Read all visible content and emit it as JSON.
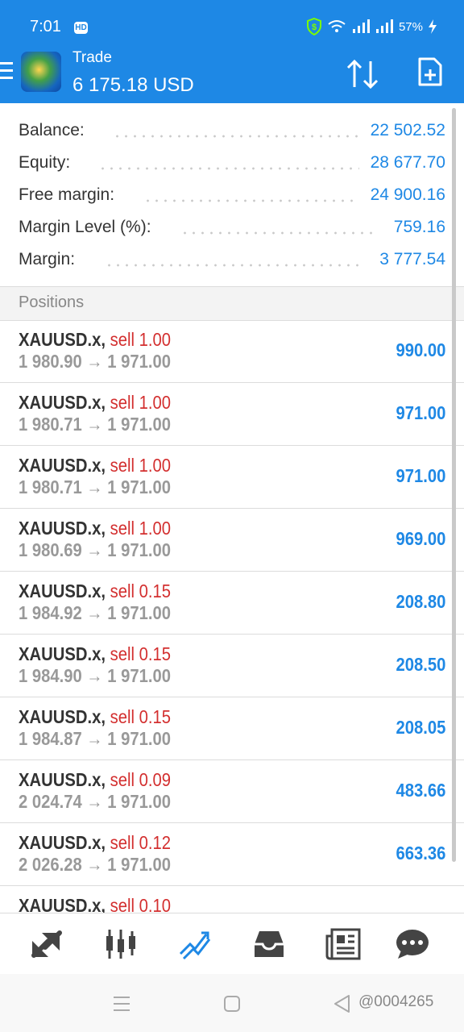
{
  "status": {
    "time": "7:01",
    "hd": "HD",
    "battery": "57%"
  },
  "header": {
    "title": "Trade",
    "subtitle": "6 175.18 USD"
  },
  "summary": [
    {
      "label": "Balance:",
      "value": "22 502.52"
    },
    {
      "label": "Equity:",
      "value": "28 677.70"
    },
    {
      "label": "Free margin:",
      "value": "24 900.16"
    },
    {
      "label": "Margin Level (%):",
      "value": "759.16"
    },
    {
      "label": "Margin:",
      "value": "3 777.54"
    }
  ],
  "positions_header": "Positions",
  "positions": [
    {
      "symbol": "XAUUSD.x,",
      "direction": "sell 1.00",
      "prices": "1 980.90 → 1 971.00",
      "profit": "990.00"
    },
    {
      "symbol": "XAUUSD.x,",
      "direction": "sell 1.00",
      "prices": "1 980.71 → 1 971.00",
      "profit": "971.00"
    },
    {
      "symbol": "XAUUSD.x,",
      "direction": "sell 1.00",
      "prices": "1 980.71 → 1 971.00",
      "profit": "971.00"
    },
    {
      "symbol": "XAUUSD.x,",
      "direction": "sell 1.00",
      "prices": "1 980.69 → 1 971.00",
      "profit": "969.00"
    },
    {
      "symbol": "XAUUSD.x,",
      "direction": "sell 0.15",
      "prices": "1 984.92 → 1 971.00",
      "profit": "208.80"
    },
    {
      "symbol": "XAUUSD.x,",
      "direction": "sell 0.15",
      "prices": "1 984.90 → 1 971.00",
      "profit": "208.50"
    },
    {
      "symbol": "XAUUSD.x,",
      "direction": "sell 0.15",
      "prices": "1 984.87 → 1 971.00",
      "profit": "208.05"
    },
    {
      "symbol": "XAUUSD.x,",
      "direction": "sell 0.09",
      "prices": "2 024.74 → 1 971.00",
      "profit": "483.66"
    },
    {
      "symbol": "XAUUSD.x,",
      "direction": "sell 0.12",
      "prices": "2 026.28 → 1 971.00",
      "profit": "663.36"
    },
    {
      "symbol": "XAUUSD.x,",
      "direction": "sell 0.10",
      "prices": "",
      "profit": ""
    }
  ],
  "bottom_nav": [
    {
      "icon": "quotes-icon",
      "active": false
    },
    {
      "icon": "chart-icon",
      "active": false
    },
    {
      "icon": "trade-icon",
      "active": true
    },
    {
      "icon": "history-icon",
      "active": false
    },
    {
      "icon": "news-icon",
      "active": false
    },
    {
      "icon": "chat-icon",
      "active": false
    }
  ],
  "system_nav": {
    "watermark": "@0004265"
  },
  "colors": {
    "header_bg": "#1e88e5",
    "accent": "#1e88e5",
    "sell": "#d32f2f",
    "icon": "#444444"
  }
}
